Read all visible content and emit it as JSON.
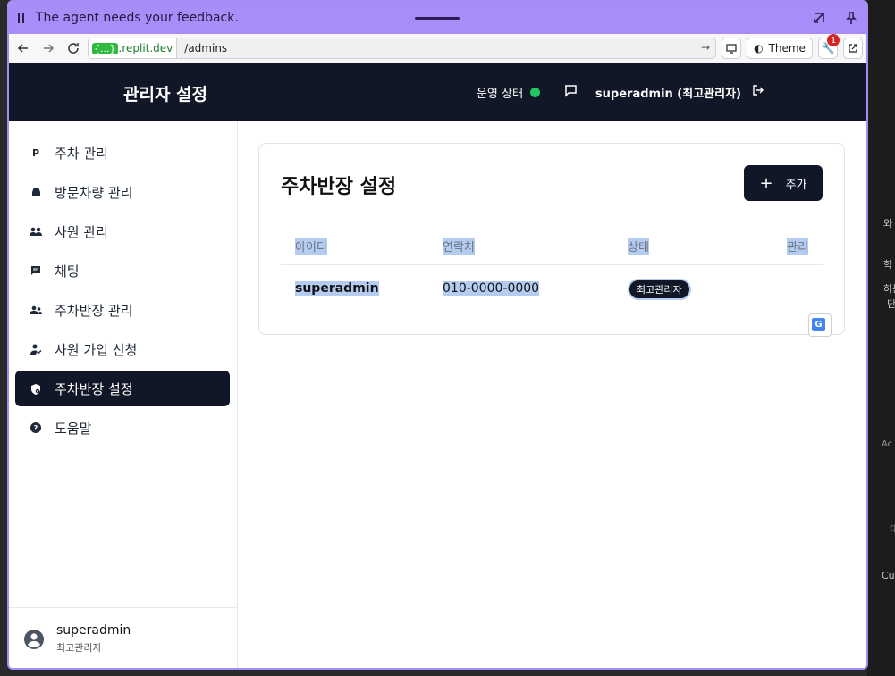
{
  "agent_bar": {
    "message": "The agent needs your feedback."
  },
  "url_bar": {
    "domain_prefix": "{...}",
    "domain": ".replit.dev",
    "path": "/admins",
    "theme_label": "Theme",
    "devtools_badge": "1"
  },
  "header": {
    "title": "관리자 설정",
    "status_label": "운영 상태",
    "user_label": "superadmin (최고관리자)"
  },
  "sidebar": {
    "items": [
      {
        "label": "주차 관리",
        "icon": "P"
      },
      {
        "label": "방문차량 관리",
        "icon": "🚗"
      },
      {
        "label": "사원 관리",
        "icon": "👥"
      },
      {
        "label": "채팅",
        "icon": "💬"
      },
      {
        "label": "주차반장 관리",
        "icon": "👥"
      },
      {
        "label": "사원 가입 신청",
        "icon": "✓"
      },
      {
        "label": "주차반장 설정",
        "icon": "🛡"
      },
      {
        "label": "도움말",
        "icon": "?"
      }
    ],
    "footer": {
      "name": "superadmin",
      "role": "최고관리자"
    }
  },
  "main": {
    "title": "주차반장 설정",
    "add_label": "추가",
    "columns": [
      "아이디",
      "연락처",
      "상태",
      "관리"
    ],
    "row": {
      "id": "superadmin",
      "phone": "010-0000-0000",
      "status": "최고관리자"
    }
  },
  "background_fragments": [
    "와",
    "학",
    "하는",
    "단",
    "Ac",
    "대",
    "Cu"
  ],
  "colors": {
    "header_bg": "#111726",
    "agent_bar": "#a88cf7",
    "status_green": "#22c55e"
  }
}
